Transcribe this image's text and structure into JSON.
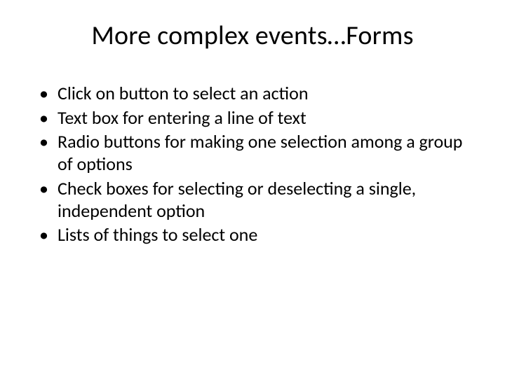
{
  "slide": {
    "title": "More complex events…Forms",
    "bullets": [
      "Click on button to select an action",
      "Text box for entering a line of text",
      "Radio buttons for making one selection among a group of options",
      "Check boxes for selecting or deselecting a single, independent option",
      "Lists of things to select one"
    ]
  }
}
